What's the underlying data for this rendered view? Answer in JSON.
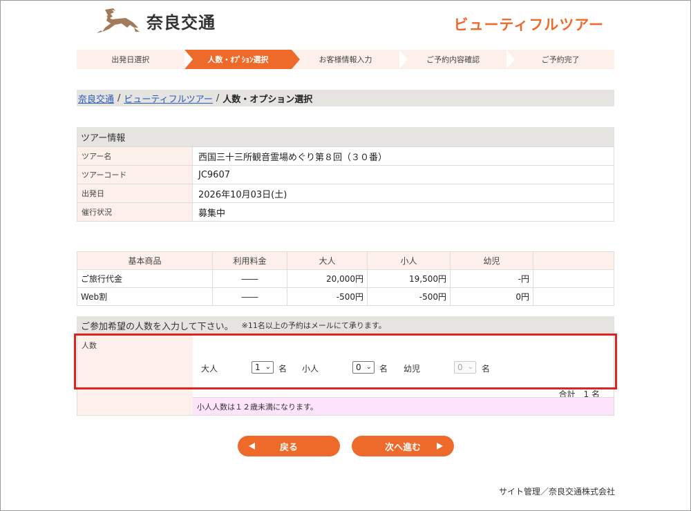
{
  "header": {
    "logo_text": "奈良交通",
    "brand": "ビューティフルツアー",
    "accent_color": "#ee6a2b"
  },
  "steps": [
    {
      "label": "出発日選択",
      "active": false
    },
    {
      "label": "人数・ｵﾌﾟｼｮﾝ選択",
      "active": true
    },
    {
      "label": "お客様情報入力",
      "active": false
    },
    {
      "label": "ご予約内容確認",
      "active": false
    },
    {
      "label": "ご予約完了",
      "active": false
    }
  ],
  "breadcrumb": {
    "link1": "奈良交通",
    "sep": "/",
    "link2": "ビューティフルツアー",
    "current": "人数・オプション選択"
  },
  "tour": {
    "title": "ツアー情報",
    "rows": [
      {
        "key": "ツアー名",
        "value": "西国三十三所観音霊場めぐり第８回（３０番）"
      },
      {
        "key": "ツアーコード",
        "value": "JC9607"
      },
      {
        "key": "出発日",
        "value": "2026年10月03日(土)"
      },
      {
        "key": "催行状況",
        "value": "募集中"
      }
    ]
  },
  "price": {
    "headers": [
      "基本商品",
      "利用料金",
      "大人",
      "小人",
      "幼児",
      ""
    ],
    "rows": [
      {
        "name": "ご旅行代金",
        "fee": "――",
        "adult": "20,000円",
        "child": "19,500円",
        "infant": "-円"
      },
      {
        "name": "Web割",
        "fee": "――",
        "adult": "-500円",
        "child": "-500円",
        "infant": "0円"
      }
    ]
  },
  "entry": {
    "title": "ご参加希望の人数を入力して下さい。",
    "note": "※11名以上の予約はメールにて承ります。",
    "key": "人数",
    "adult_label": "大人",
    "adult_value": "1",
    "child_label": "小人",
    "child_value": "0",
    "infant_label": "幼児",
    "infant_value": "0",
    "unit": "名",
    "total": "合計　1 名"
  },
  "hint": "小人人数は１２歳未満になります。",
  "buttons": {
    "back": "戻る",
    "next": "次へ進む"
  },
  "footer": "サイト管理／奈良交通株式会社"
}
